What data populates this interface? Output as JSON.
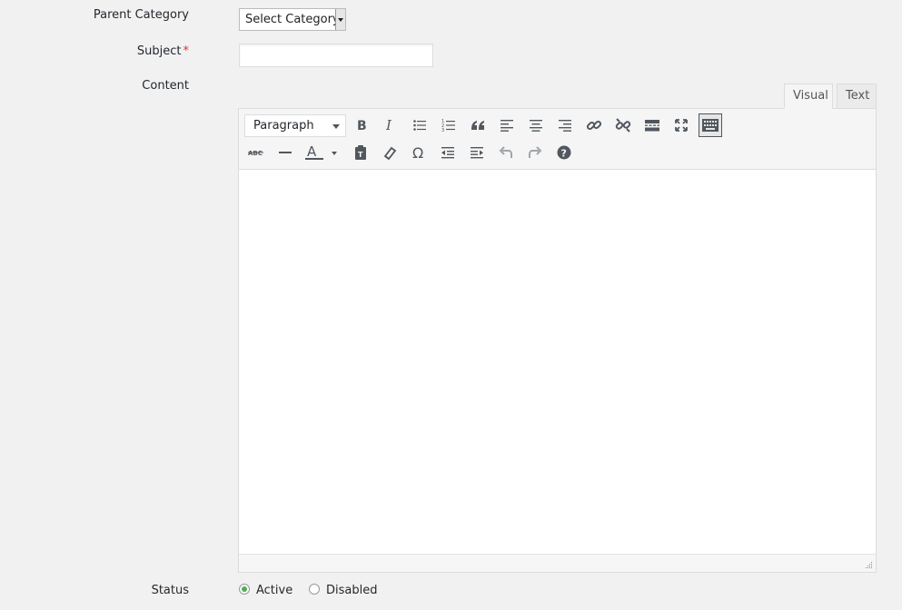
{
  "form": {
    "parent_category_label": "Parent Category",
    "parent_category_value": "Select Category",
    "subject_label": "Subject",
    "subject_required_mark": "*",
    "subject_value": "",
    "content_label": "Content",
    "status_label": "Status",
    "status_options": [
      {
        "label": "Active",
        "checked": true
      },
      {
        "label": "Disabled",
        "checked": false
      }
    ]
  },
  "editor": {
    "tabs": [
      {
        "label": "Visual",
        "active": true
      },
      {
        "label": "Text",
        "active": false
      }
    ],
    "format_select": "Paragraph",
    "toolbar_row1": [
      "bold",
      "italic",
      "bullet-list",
      "numbered-list",
      "blockquote",
      "align-left",
      "align-center",
      "align-right",
      "insert-link",
      "unlink",
      "read-more",
      "fullscreen",
      "toolbar-toggle"
    ],
    "toolbar_row2": [
      "strikethrough",
      "horizontal-line",
      "text-color",
      "paste-as-text",
      "clear-formatting",
      "special-character",
      "outdent",
      "indent",
      "undo",
      "redo",
      "keyboard-shortcuts"
    ],
    "content": ""
  },
  "colors": {
    "background": "#f1f1f1",
    "required": "#dc3232",
    "radio_checked": "#4caf50",
    "icon": "#50575e"
  }
}
